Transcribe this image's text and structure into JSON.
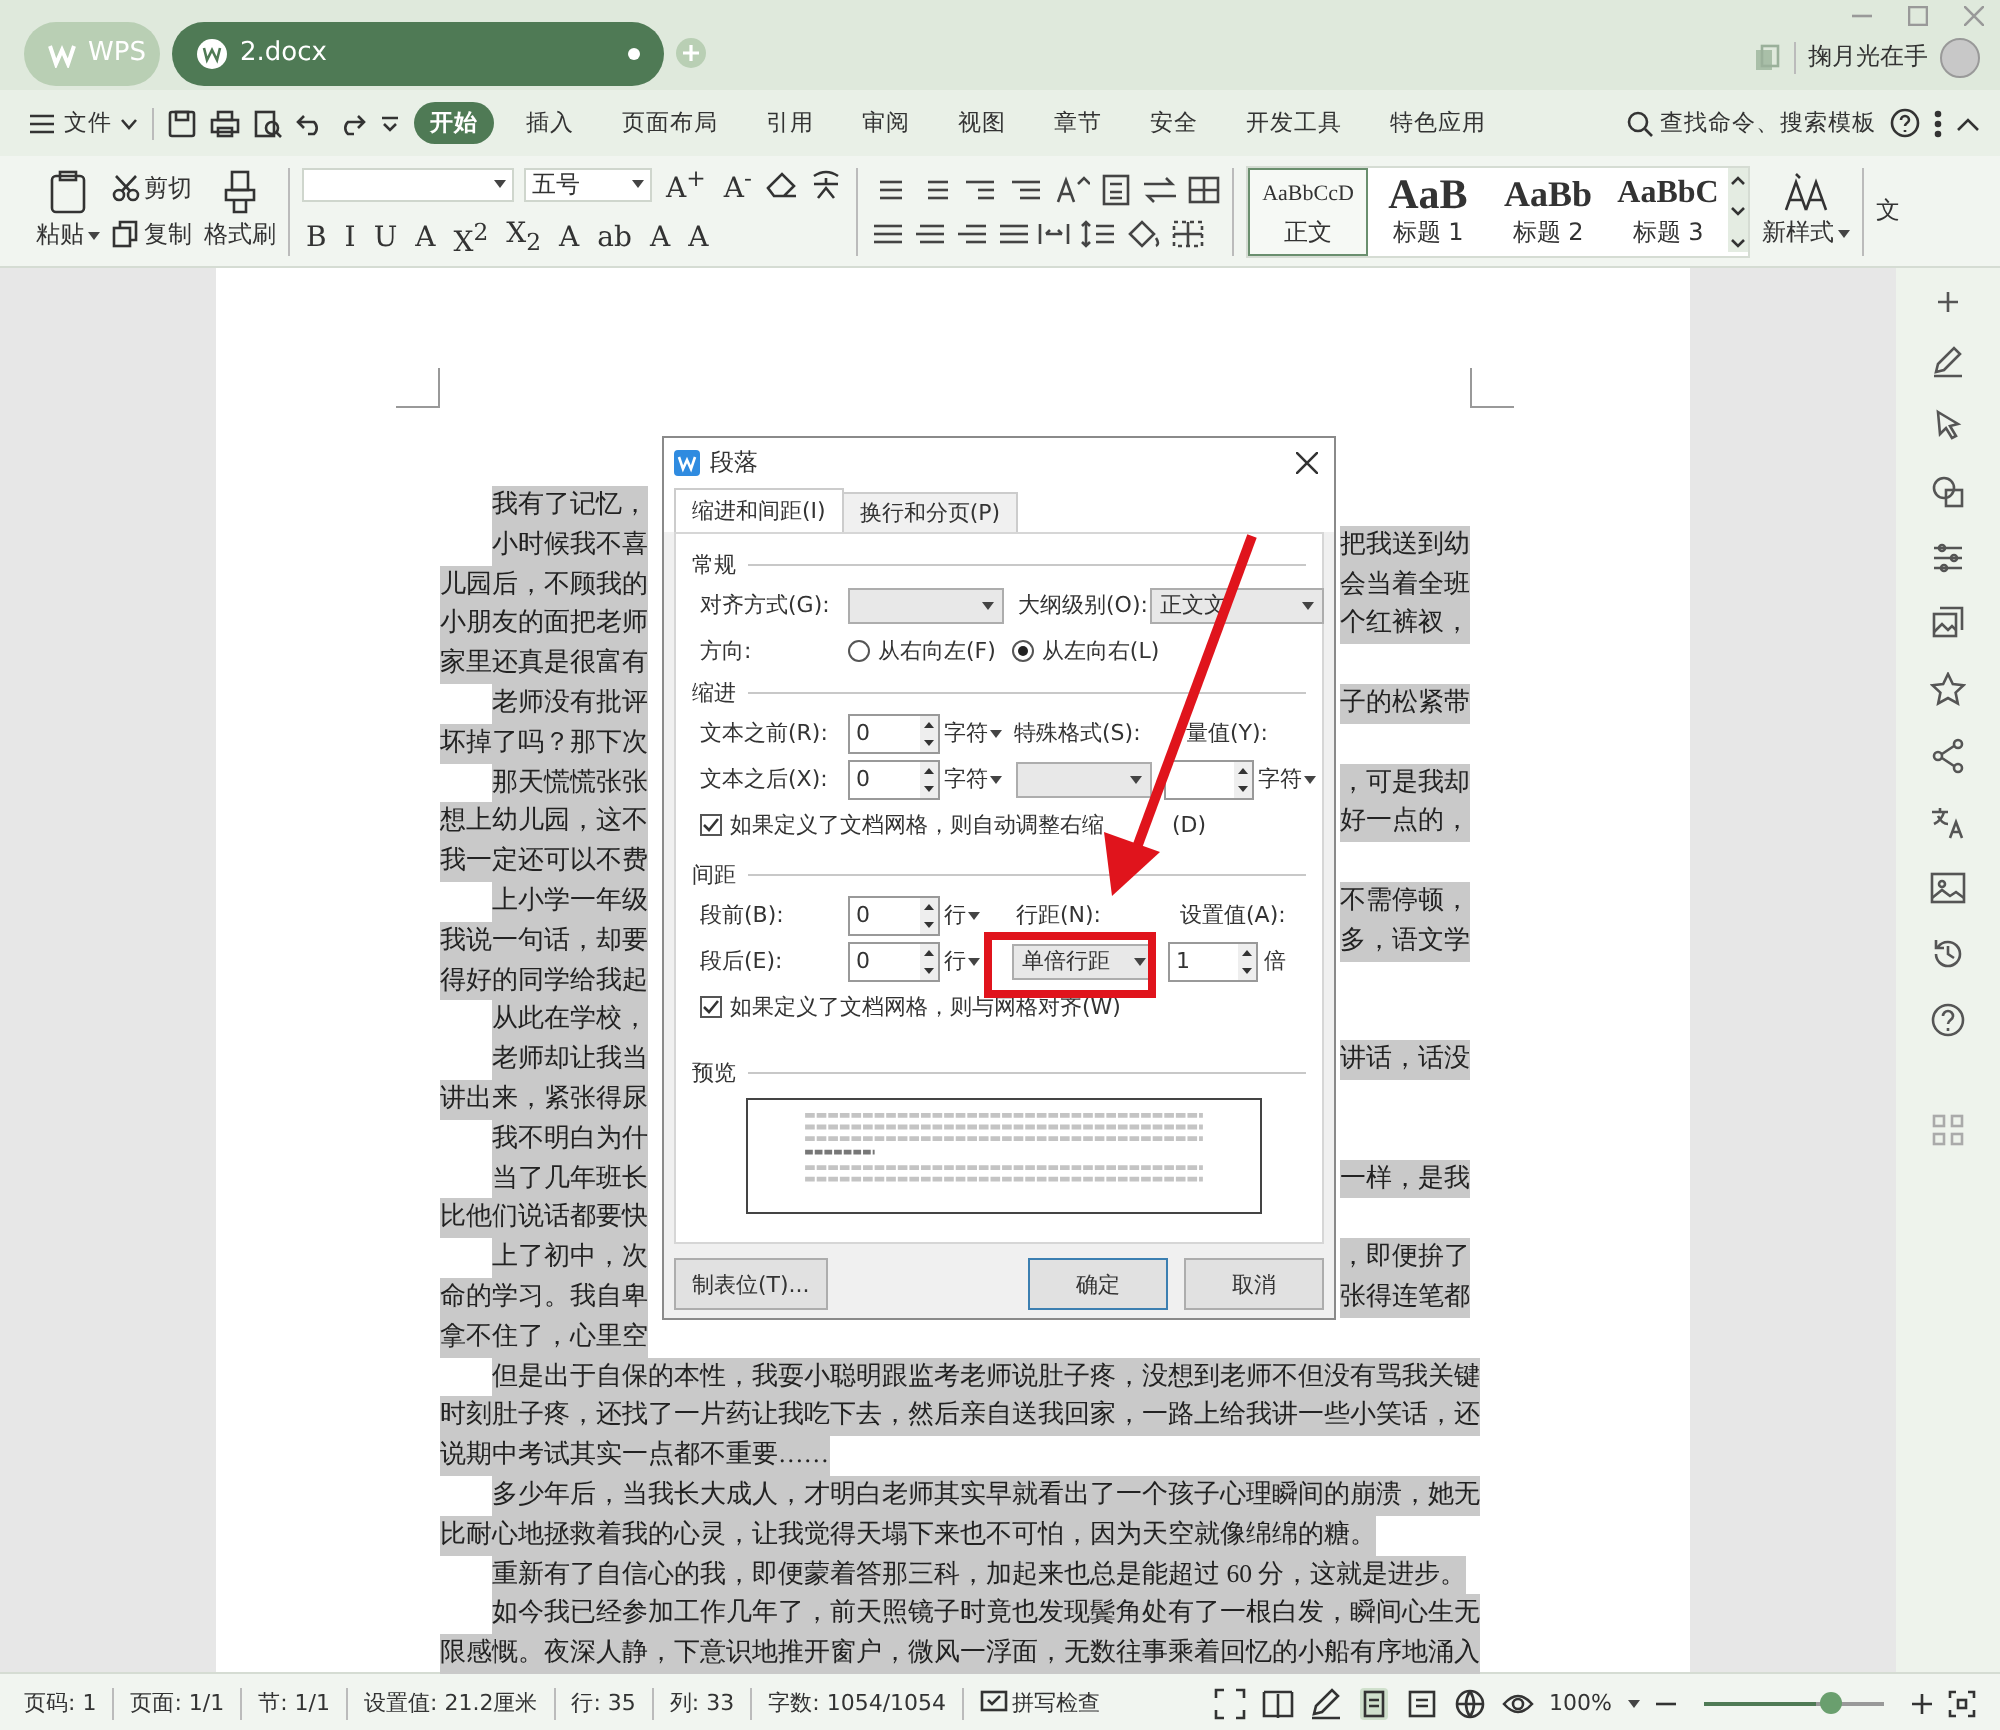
{
  "tabs": [
    {
      "label": "WPS",
      "kind": "home",
      "selected": false
    },
    {
      "label": "2.docx",
      "kind": "doc",
      "selected": true
    }
  ],
  "user": {
    "name": "掬月光在手"
  },
  "menu": {
    "file": "文件",
    "tabs": [
      {
        "label": "开始",
        "selected": true
      },
      {
        "label": "插入",
        "selected": false
      },
      {
        "label": "页面布局",
        "selected": false
      },
      {
        "label": "引用",
        "selected": false
      },
      {
        "label": "审阅",
        "selected": false
      },
      {
        "label": "视图",
        "selected": false
      },
      {
        "label": "章节",
        "selected": false
      },
      {
        "label": "安全",
        "selected": false
      },
      {
        "label": "开发工具",
        "selected": false
      },
      {
        "label": "特色应用",
        "selected": false
      }
    ],
    "search": "查找命令、搜索模板"
  },
  "ribbon": {
    "paste": "粘贴",
    "cut": "剪切",
    "copy": "复制",
    "format_painter": "格式刷",
    "font_size": "五号",
    "grow_shrink": [
      "A$^{+}$",
      "A$^{-}$"
    ],
    "format_letters": [
      "B",
      "I",
      "U",
      "A",
      "X$^{2}$",
      "X$_{2}$",
      "A",
      "ab",
      "A",
      "A"
    ],
    "styles": [
      {
        "sample": "AaBbCcD",
        "label": "正文",
        "kind": "body",
        "selected": true
      },
      {
        "sample": "AaB",
        "label": "标题 1",
        "kind": "h1",
        "selected": false
      },
      {
        "sample": "AaBb",
        "label": "标题 2",
        "kind": "h2",
        "selected": false
      },
      {
        "sample": "AaBbC",
        "label": "标题 3",
        "kind": "h3",
        "selected": false
      }
    ],
    "new_style": "新样式",
    "more": "文"
  },
  "document": {
    "selected": true,
    "lines": [
      {
        "indent": true,
        "left": "我有了记忆，"
      },
      {
        "indent": true,
        "left": "小时候我不喜",
        "right": "把我送到幼"
      },
      {
        "indent": false,
        "left": "儿园后，不顾我的",
        "right": "会当着全班"
      },
      {
        "indent": false,
        "left": "小朋友的面把老师",
        "right": "个红裤衩，"
      },
      {
        "indent": false,
        "left": "家里还真是很富有"
      },
      {
        "indent": true,
        "left": "老师没有批评",
        "right": "子的松紧带"
      },
      {
        "indent": false,
        "left": "坏掉了吗？那下次"
      },
      {
        "indent": true,
        "left": "那天慌慌张张",
        "right": "，可是我却"
      },
      {
        "indent": false,
        "left": "想上幼儿园，这不",
        "right": "好一点的，"
      },
      {
        "indent": false,
        "left": "我一定还可以不费"
      },
      {
        "indent": true,
        "left": "上小学一年级",
        "right": "不需停顿，"
      },
      {
        "indent": false,
        "left": "我说一句话，却要",
        "right": "多，语文学"
      },
      {
        "indent": false,
        "left": "得好的同学给我起"
      },
      {
        "indent": true,
        "left": "从此在学校，"
      },
      {
        "indent": true,
        "left": "老师却让我当",
        "right": "讲话，话没"
      },
      {
        "indent": false,
        "left": "讲出来，紧张得尿"
      },
      {
        "indent": true,
        "left": "我不明白为什"
      },
      {
        "indent": true,
        "left": "当了几年班长",
        "right": "一样，是我"
      },
      {
        "indent": false,
        "left": "比他们说话都要快"
      },
      {
        "indent": true,
        "left": "上了初中，次",
        "right": "，即便拚了"
      },
      {
        "indent": false,
        "left": "命的学习。我自卑",
        "right": "张得连笔都"
      },
      {
        "indent": false,
        "left": "拿不住了，心里空"
      },
      {
        "indent": true,
        "left": "但是出于自保的本性，我耍小聪明跟监考老师说肚子疼，没想到老师不但没有骂我关键"
      },
      {
        "indent": false,
        "left": "时刻肚子疼，还找了一片药让我吃下去，然后亲自送我回家，一路上给我讲一些小笑话，还"
      },
      {
        "indent": false,
        "left": "说期中考试其实一点都不重要……"
      },
      {
        "indent": true,
        "left": "多少年后，当我长大成人，才明白老师其实早就看出了一个孩子心理瞬间的崩溃，她无"
      },
      {
        "indent": false,
        "left": "比耐心地拯救着我的心灵，让我觉得天塌下来也不可怕，因为天空就像绵绵的糖。"
      },
      {
        "indent": true,
        "left": "重新有了自信心的我，即便蒙着答那三科，加起来也总是能超过 60 分，这就是进步。"
      },
      {
        "indent": true,
        "left": "如今我已经参加工作几年了，前天照镜子时竟也发现鬓角处有了一根白发，瞬间心生无"
      },
      {
        "indent": false,
        "left": "限感慨。夜深人静，下意识地推开窗户，微风一浮面，无数往事乘着回忆的小船有序地涌入"
      }
    ]
  },
  "dialog": {
    "title": "段落",
    "tabs": [
      {
        "label": "缩进和间距(I)",
        "selected": true
      },
      {
        "label": "换行和分页(P)",
        "selected": false
      }
    ],
    "general": {
      "heading": "常规",
      "alignment_label": "对齐方式(G):",
      "outline_label": "大纲级别(O):",
      "outline_value": "正文文",
      "direction_label": "方向:",
      "directions": [
        {
          "label": "从右向左(F)",
          "selected": false
        },
        {
          "label": "从左向右(L)",
          "selected": true
        }
      ]
    },
    "indent": {
      "heading": "缩进",
      "before_label": "文本之前(R):",
      "before_value": "0",
      "before_unit": "字符",
      "special_label": "特殊格式(S):",
      "measure_label": "量值(Y):",
      "after_label": "文本之后(X):",
      "after_value": "0",
      "after_unit": "字符",
      "measure_unit": "字符",
      "auto_adjust": {
        "label": "如果定义了文档网格，则自动调整右缩",
        "tail": "(D)",
        "checked": true
      }
    },
    "spacing": {
      "heading": "间距",
      "before_label": "段前(B):",
      "before_value": "0",
      "before_unit": "行",
      "line_label": "行距(N):",
      "setting_label": "设置值(A):",
      "after_label": "段后(E):",
      "after_value": "0",
      "after_unit": "行",
      "line_value": "单倍行距",
      "setting_value": "1",
      "setting_unit": "倍",
      "snap_grid": {
        "label": "如果定义了文档网格，则与网格对齐(W)",
        "checked": true
      }
    },
    "preview": {
      "heading": "预览"
    },
    "buttons": {
      "tabs": "制表位(T)...",
      "ok": "确定",
      "cancel": "取消"
    }
  },
  "status_bar": {
    "items": [
      "页码: 1",
      "页面: 1/1",
      "节: 1/1",
      "设置值: 21.2厘米",
      "行: 35",
      "列: 33",
      "字数: 1054/1054"
    ],
    "spell_check": "拼写检查",
    "zoom": "100%",
    "zoom_slider": {
      "level": 0.62
    }
  }
}
